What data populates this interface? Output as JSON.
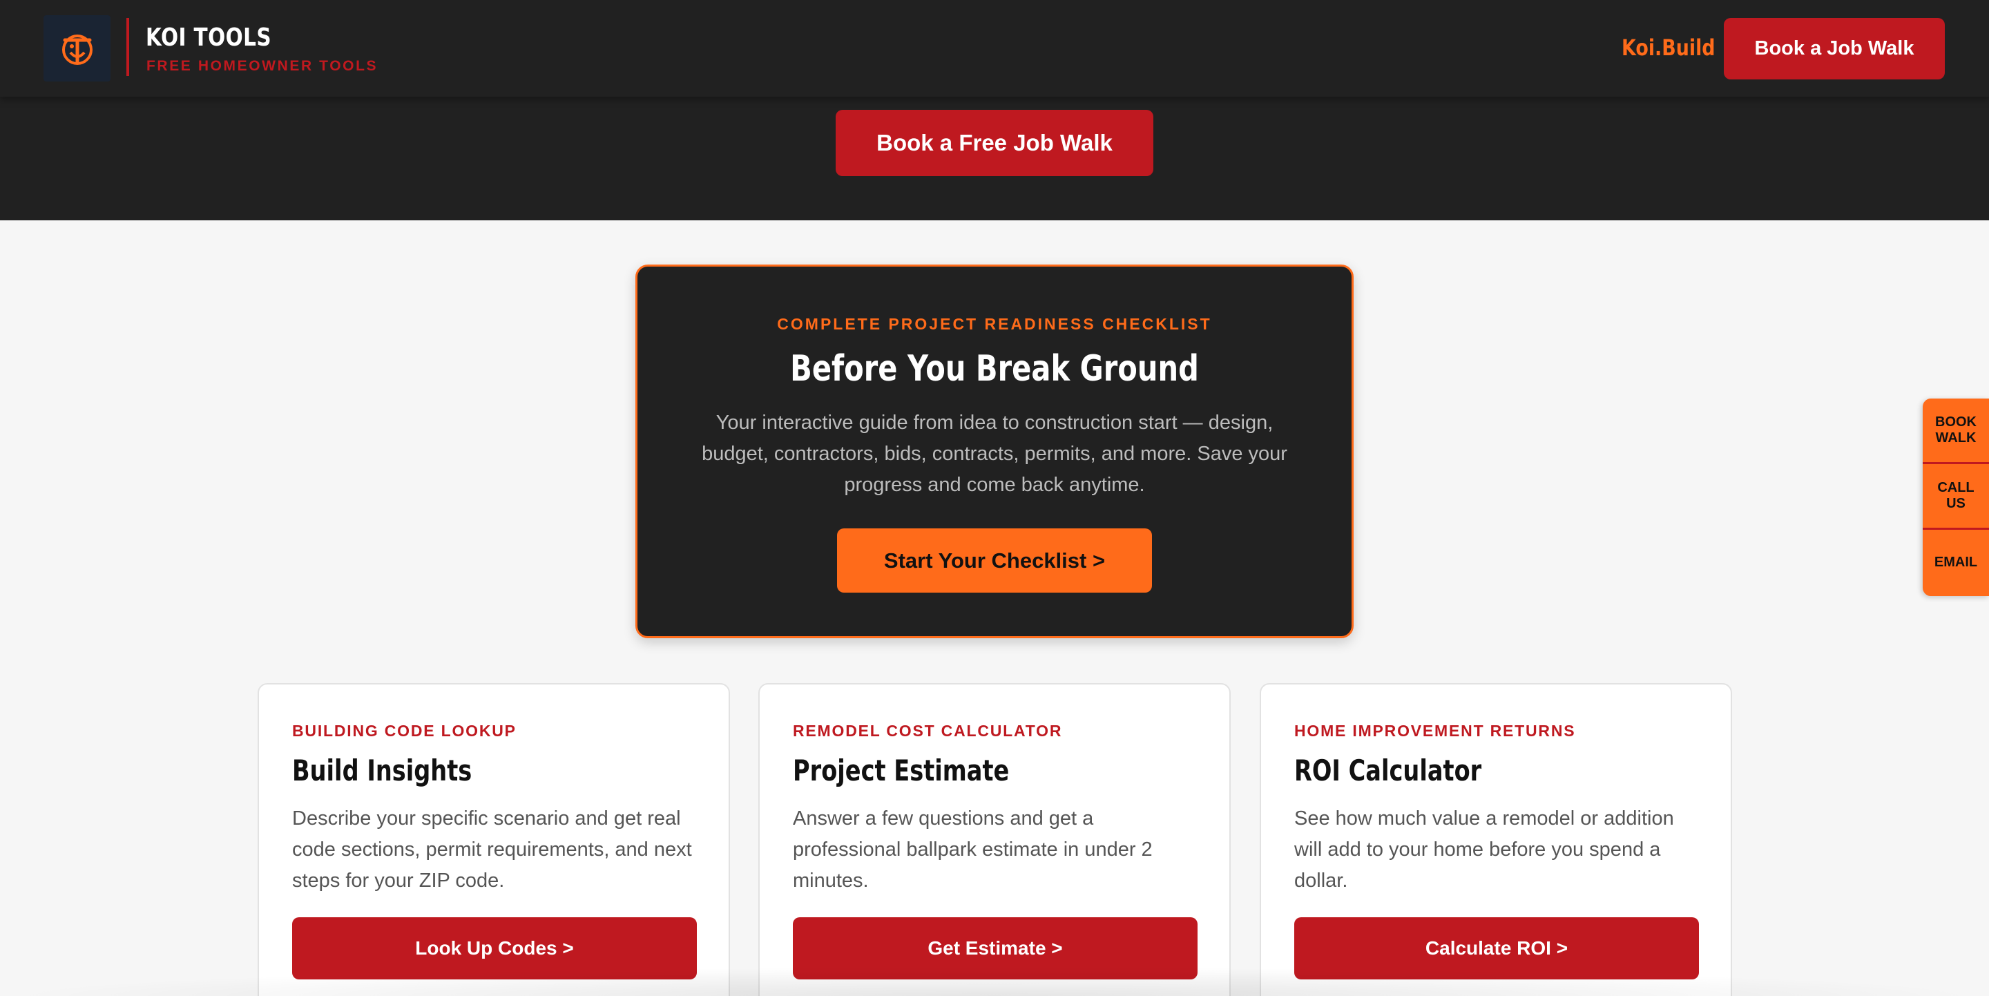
{
  "header": {
    "brand_title": "KOI TOOLS",
    "brand_subtitle": "FREE HOMEOWNER TOOLS",
    "logo_icon": "koi-logo-icon",
    "site_link": "Koi.Build",
    "cta_label": "Book a Job Walk"
  },
  "hero": {
    "cta_label": "Book a Free Job Walk"
  },
  "checklist": {
    "eyebrow": "COMPLETE PROJECT READINESS CHECKLIST",
    "title": "Before You Break Ground",
    "description": "Your interactive guide from idea to construction start — design, budget, contractors, bids, contracts, permits, and more. Save your progress and come back anytime.",
    "cta_label": "Start Your Checklist >"
  },
  "tools": [
    {
      "eyebrow": "BUILDING CODE LOOKUP",
      "title": "Build Insights",
      "description": "Describe your specific scenario and get real code sections, permit requirements, and next steps for your ZIP code.",
      "cta_label": "Look Up Codes >"
    },
    {
      "eyebrow": "REMODEL COST CALCULATOR",
      "title": "Project Estimate",
      "description": "Answer a few questions and get a professional ballpark estimate in under 2 minutes.",
      "cta_label": "Get Estimate >"
    },
    {
      "eyebrow": "HOME IMPROVEMENT RETURNS",
      "title": "ROI Calculator",
      "description": "See how much value a remodel or addition will add to your home before you spend a dollar.",
      "cta_label": "Calculate ROI >"
    }
  ],
  "side_tab": {
    "items": [
      "BOOK WALK",
      "CALL US",
      "EMAIL"
    ]
  },
  "colors": {
    "dark": "#212121",
    "brand_red": "#bf1920",
    "accent_orange": "#ff6b1a",
    "page_bg": "#f6f6f6"
  }
}
